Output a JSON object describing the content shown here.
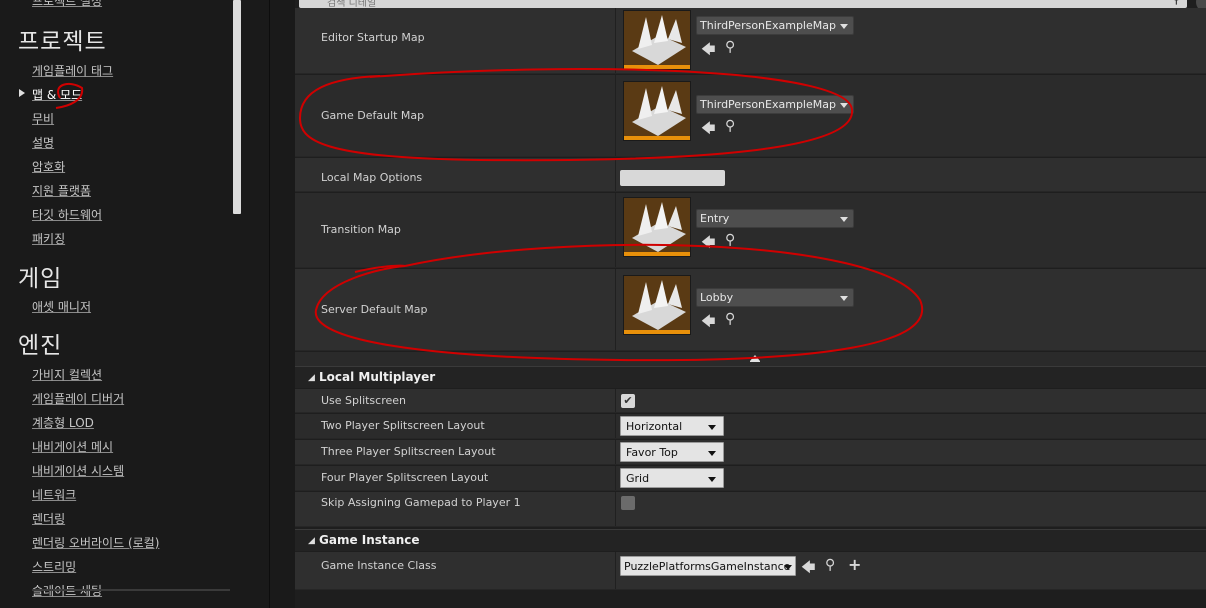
{
  "sidebar": {
    "top_cut_item": "프로젝트 설정",
    "sections": [
      {
        "title": "프로젝트",
        "items": [
          "게임플레이 태그",
          "맵 & 모드",
          "무비",
          "설명",
          "암호화",
          "지원 플랫폼",
          "타깃 하드웨어",
          "패키징"
        ]
      },
      {
        "title": "게임",
        "items": [
          "애셋 매니저"
        ]
      },
      {
        "title": "엔진",
        "items": [
          "가비지 컬렉션",
          "게임플레이 디버거",
          "계층형 LOD",
          "내비게이션 메시",
          "내비게이션 시스템",
          "네트워크",
          "렌더링",
          "렌더링 오버라이드 (로컬)",
          "스트리밍",
          "슬레이트 세팅"
        ]
      }
    ]
  },
  "search": {
    "placeholder": "검색 디테일"
  },
  "maps": {
    "editor_startup": {
      "label": "Editor Startup Map",
      "value": "ThirdPersonExampleMap"
    },
    "game_default": {
      "label": "Game Default Map",
      "value": "ThirdPersonExampleMap"
    },
    "local_options": {
      "label": "Local Map Options",
      "value": ""
    },
    "transition": {
      "label": "Transition Map",
      "value": "Entry"
    },
    "server_default": {
      "label": "Server Default Map",
      "value": "Lobby"
    }
  },
  "local_multiplayer": {
    "title": "Local Multiplayer",
    "use_splitscreen": {
      "label": "Use Splitscreen",
      "checked": true
    },
    "two_player": {
      "label": "Two Player Splitscreen Layout",
      "value": "Horizontal"
    },
    "three_player": {
      "label": "Three Player Splitscreen Layout",
      "value": "Favor Top"
    },
    "four_player": {
      "label": "Four Player Splitscreen Layout",
      "value": "Grid"
    },
    "skip_gamepad": {
      "label": "Skip Assigning Gamepad to Player 1",
      "checked": false
    }
  },
  "game_instance": {
    "title": "Game Instance",
    "class_label": "Game Instance Class",
    "class_value": "PuzzlePlatformsGameInstance"
  },
  "icons": {
    "browse_back": "arrow-left-icon",
    "find": "search-icon",
    "add": "plus-icon",
    "check": "✔"
  },
  "colors": {
    "annotation": "#d00000",
    "thumb_bar": "#e8900a",
    "thumb_bg": "#5a3a14"
  }
}
